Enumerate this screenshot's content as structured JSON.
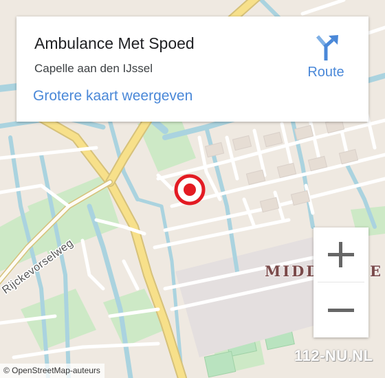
{
  "card": {
    "name": "Ambulance Met Spoed",
    "city": "Capelle aan den IJssel",
    "bigger_map": "Grotere kaart weergeven",
    "route_label": "Route",
    "route_icon": "route-arrow-icon"
  },
  "map": {
    "street_label": "Rijckevorselweg",
    "district_label": "MIDD",
    "district_label_tail": "E",
    "marker_icon": "location-target-icon",
    "marker_color": "#e31b23",
    "accent_color": "#4a88d8"
  },
  "zoom": {
    "in_label": "+",
    "out_label": "−"
  },
  "attribution": "© OpenStreetMap-auteurs",
  "watermark": "112-NU.NL"
}
